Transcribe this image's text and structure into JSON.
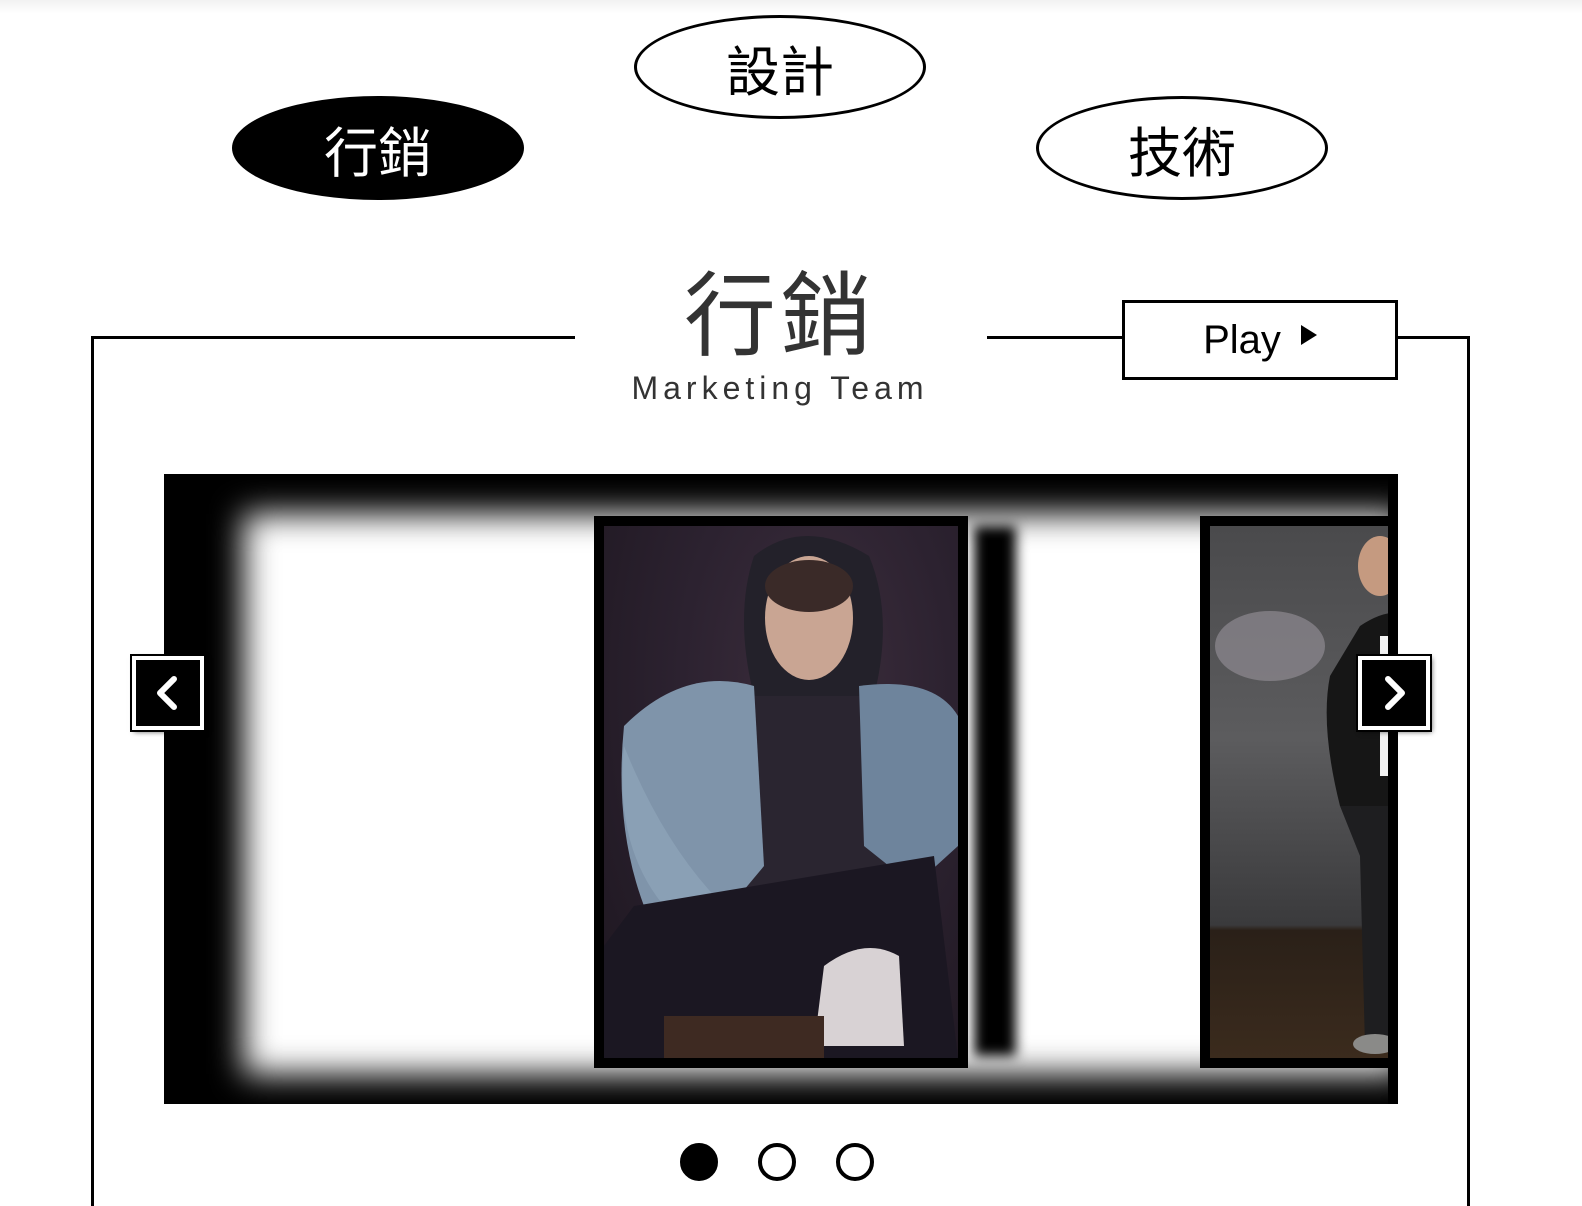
{
  "tabs": [
    {
      "label": "行銷",
      "active": true
    },
    {
      "label": "設計",
      "active": false
    },
    {
      "label": "技術",
      "active": false
    }
  ],
  "section": {
    "title": "行銷",
    "subtitle": "Marketing Team"
  },
  "controls": {
    "play_label": "Play",
    "play_icon": "play-triangle-icon",
    "prev_icon": "chevron-left-icon",
    "next_icon": "chevron-right-icon"
  },
  "carousel": {
    "slides": [
      {
        "description_icon": "team-member-photo"
      },
      {
        "description_icon": "team-member-photo"
      },
      {
        "description_icon": "team-member-photo"
      }
    ],
    "active_index": 0,
    "dots": 3
  },
  "colors": {
    "primary": "#000000",
    "background": "#ffffff",
    "heading_text": "#333333"
  }
}
